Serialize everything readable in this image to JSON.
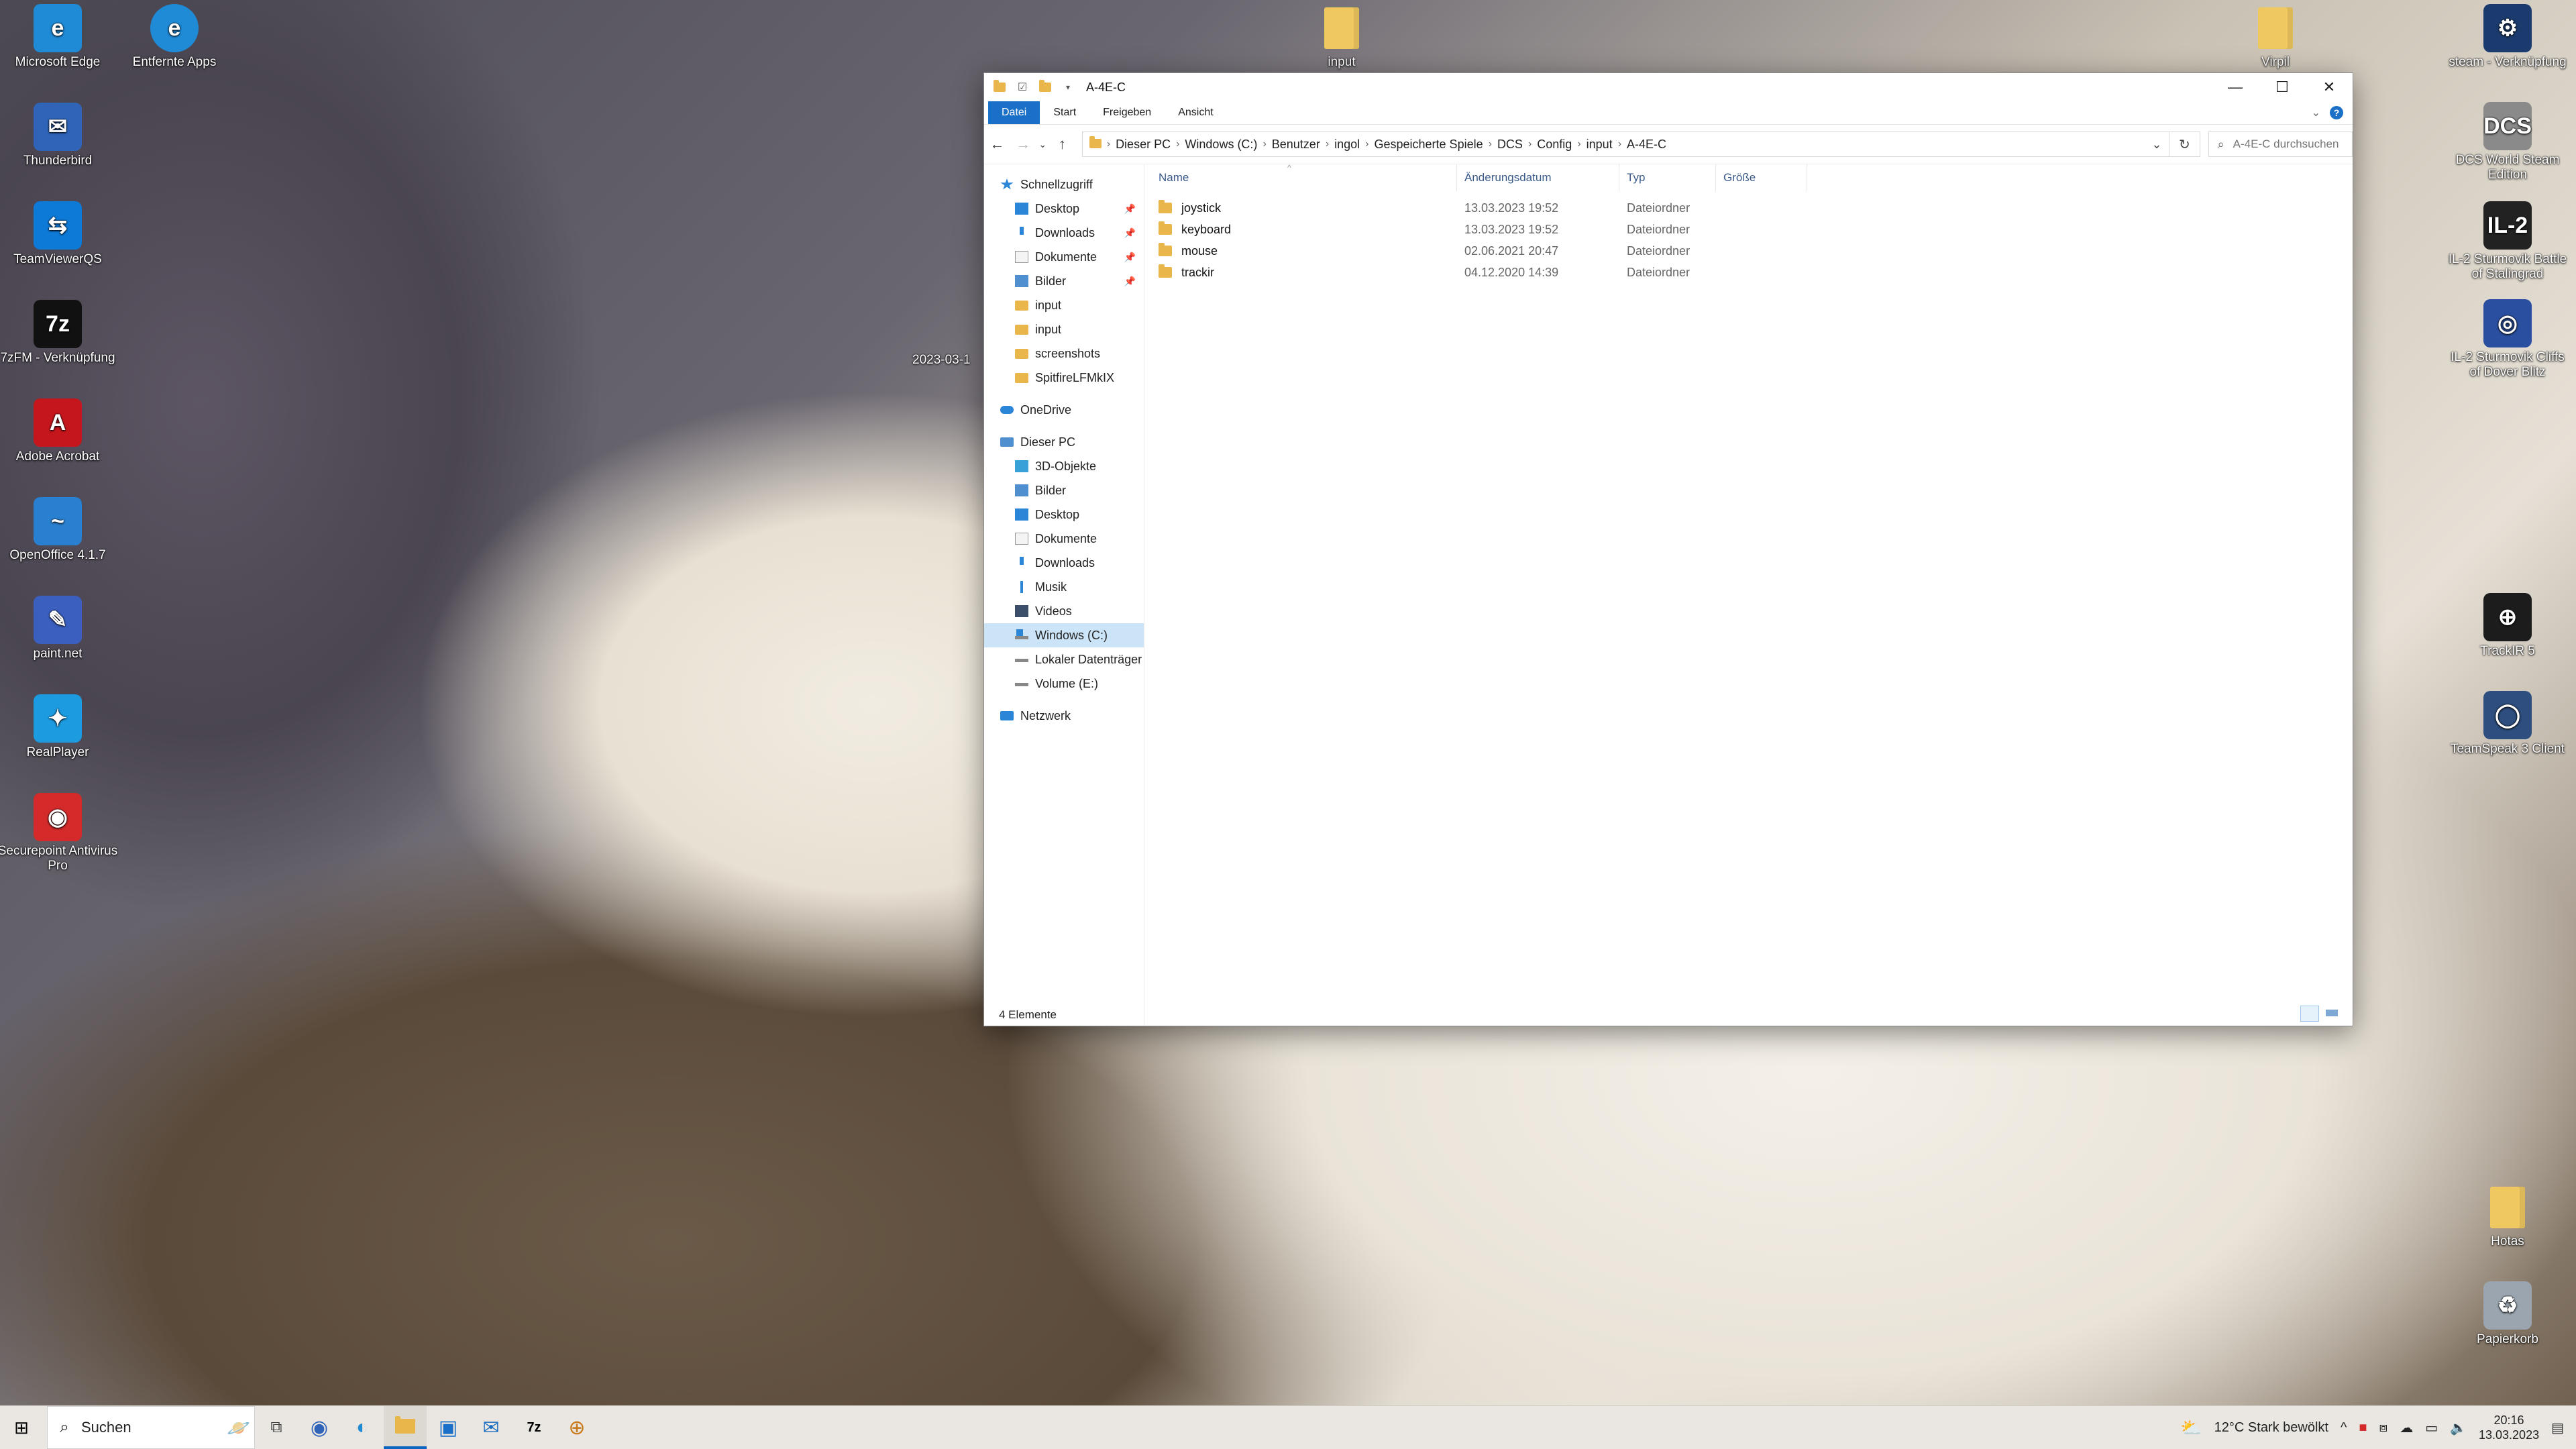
{
  "desktop": {
    "left_icons": [
      {
        "label": "Microsoft Edge",
        "glyph": "e",
        "color": "#1f8ad6"
      },
      {
        "label": "Thunderbird",
        "glyph": "✉",
        "color": "#2f64b8"
      },
      {
        "label": "TeamViewerQS",
        "glyph": "⇆",
        "color": "#0e7ad8"
      },
      {
        "label": "7zFM - Verknüpfung",
        "glyph": "7z",
        "color": "#111111"
      },
      {
        "label": "Adobe Acrobat",
        "glyph": "A",
        "color": "#c4161c"
      },
      {
        "label": "OpenOffice 4.1.7",
        "glyph": "~",
        "color": "#2a80d0"
      },
      {
        "label": "paint.net",
        "glyph": "✎",
        "color": "#3a5fbf"
      },
      {
        "label": "RealPlayer",
        "glyph": "✦",
        "color": "#1c9be0"
      },
      {
        "label": "Securepoint Antivirus Pro",
        "glyph": "◉",
        "color": "#d52a2a"
      }
    ],
    "col2_icon": {
      "label": "Entfernte Apps",
      "glyph": "e",
      "color": "#1f8ad6"
    },
    "top_icons": [
      {
        "label": "input",
        "glyph": "",
        "color": "#f0c860"
      },
      {
        "label": "Virpil",
        "glyph": "",
        "color": "#f0c860"
      }
    ],
    "partial_label": "2023-03-1",
    "right_icons": [
      {
        "label": "steam - Verknüpfung",
        "glyph": "⚙",
        "color": "#1b3b6f"
      },
      {
        "label": "DCS World Steam Edition",
        "glyph": "DCS",
        "color": "#8a8a8a"
      },
      {
        "label": "IL-2 Sturmovik Battle of Stalingrad",
        "glyph": "IL-2",
        "color": "#222222"
      },
      {
        "label": "IL-2 Sturmovik Cliffs of Dover Blitz",
        "glyph": "◎",
        "color": "#2a4fa0"
      },
      {
        "label": "TrackIR 5",
        "glyph": "⊕",
        "color": "#1c1c1c"
      },
      {
        "label": "TeamSpeak 3 Client",
        "glyph": "◯",
        "color": "#2d4e7e"
      },
      {
        "label": "Hotas",
        "glyph": "",
        "color": "#f0c860"
      },
      {
        "label": "Papierkorb",
        "glyph": "♻",
        "color": "#9aa5b0"
      }
    ]
  },
  "window": {
    "title": "A-4E-C",
    "ribbon_tabs": [
      "Datei",
      "Start",
      "Freigeben",
      "Ansicht"
    ],
    "help_label": "?",
    "breadcrumb": [
      "Dieser PC",
      "Windows (C:)",
      "Benutzer",
      "ingol",
      "Gespeicherte Spiele",
      "DCS",
      "Config",
      "input",
      "A-4E-C"
    ],
    "search_placeholder": "A-4E-C durchsuchen",
    "nav": {
      "quick_access": "Schnellzugriff",
      "quick_items": [
        {
          "label": "Desktop",
          "pinned": true
        },
        {
          "label": "Downloads",
          "pinned": true
        },
        {
          "label": "Dokumente",
          "pinned": true
        },
        {
          "label": "Bilder",
          "pinned": true
        },
        {
          "label": "input",
          "pinned": false
        },
        {
          "label": "input",
          "pinned": false
        },
        {
          "label": "screenshots",
          "pinned": false
        },
        {
          "label": "SpitfireLFMkIX",
          "pinned": false
        }
      ],
      "onedrive": "OneDrive",
      "this_pc": "Dieser PC",
      "pc_items": [
        "3D-Objekte",
        "Bilder",
        "Desktop",
        "Dokumente",
        "Downloads",
        "Musik",
        "Videos",
        "Windows (C:)",
        "Lokaler Datenträger",
        "Volume (E:)"
      ],
      "selected": "Windows (C:)",
      "network": "Netzwerk"
    },
    "columns": {
      "name": "Name",
      "date": "Änderungsdatum",
      "type": "Typ",
      "size": "Größe"
    },
    "files": [
      {
        "name": "joystick",
        "date": "13.03.2023 19:52",
        "type": "Dateiordner"
      },
      {
        "name": "keyboard",
        "date": "13.03.2023 19:52",
        "type": "Dateiordner"
      },
      {
        "name": "mouse",
        "date": "02.06.2021 20:47",
        "type": "Dateiordner"
      },
      {
        "name": "trackir",
        "date": "04.12.2020 14:39",
        "type": "Dateiordner"
      }
    ],
    "status": "4 Elemente"
  },
  "taskbar": {
    "search_label": "Suchen",
    "weather": "12°C  Stark bewölkt",
    "time": "20:16",
    "date": "13.03.2023"
  }
}
